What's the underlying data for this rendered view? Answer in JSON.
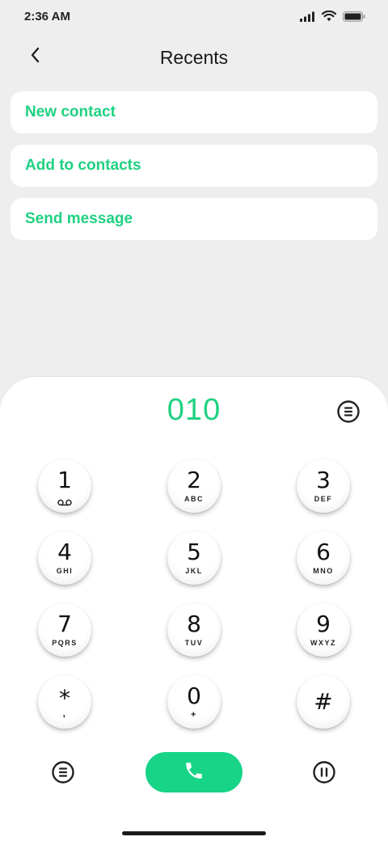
{
  "status_bar": {
    "time": "2:36 AM",
    "icons": [
      "signal-icon",
      "wifi-icon",
      "battery-icon"
    ]
  },
  "header": {
    "title": "Recents",
    "back_icon": "chevron-left-icon"
  },
  "actions": [
    {
      "label": "New contact"
    },
    {
      "label": "Add to contacts"
    },
    {
      "label": "Send message"
    }
  ],
  "dialer": {
    "number": "010",
    "menu_icon": "menu-circle-icon",
    "keys": [
      {
        "digit": "1",
        "letters": "",
        "icon": "voicemail-icon"
      },
      {
        "digit": "2",
        "letters": "ABC"
      },
      {
        "digit": "3",
        "letters": "DEF"
      },
      {
        "digit": "4",
        "letters": "GHI"
      },
      {
        "digit": "5",
        "letters": "JKL"
      },
      {
        "digit": "6",
        "letters": "MNO"
      },
      {
        "digit": "7",
        "letters": "PQRS"
      },
      {
        "digit": "8",
        "letters": "TUV"
      },
      {
        "digit": "9",
        "letters": "WXYZ"
      },
      {
        "digit": "*",
        "letters": ","
      },
      {
        "digit": "0",
        "letters": "+"
      },
      {
        "digit": "#",
        "letters": ""
      }
    ],
    "bottom": {
      "left_icon": "menu-circle-icon",
      "call_icon": "phone-icon",
      "right_icon": "pause-circle-icon"
    }
  },
  "colors": {
    "accent": "#1fd181",
    "call_button": "#18d487",
    "background": "#eeeeee",
    "card": "#ffffff"
  }
}
